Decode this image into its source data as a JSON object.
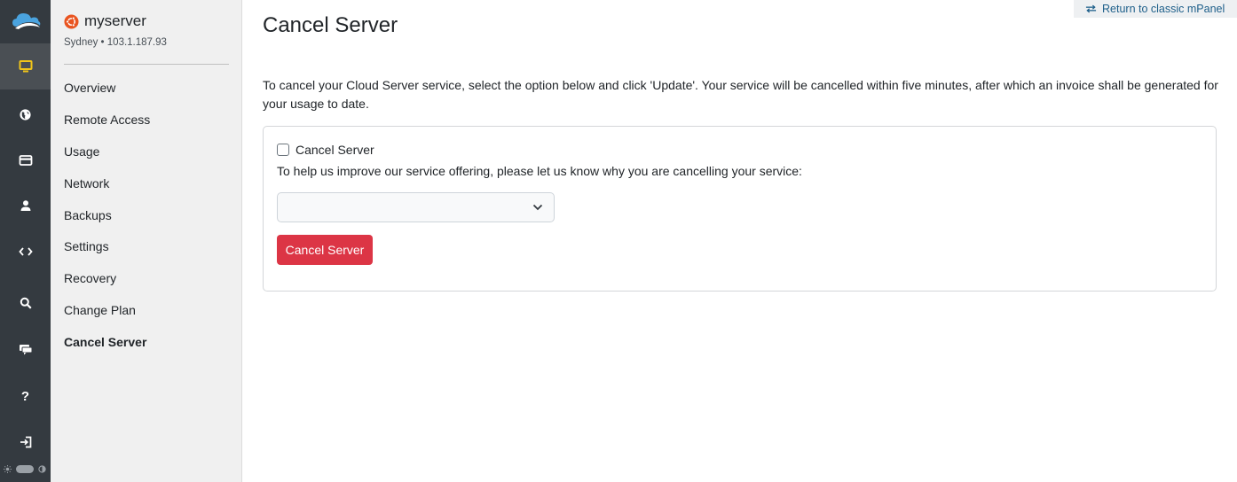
{
  "rail": {
    "items": [
      {
        "name": "servers-icon",
        "active": true
      },
      {
        "name": "globe-icon",
        "active": false
      },
      {
        "name": "billing-card-icon",
        "active": false
      },
      {
        "name": "account-user-icon",
        "active": false
      },
      {
        "name": "developer-code-icon",
        "active": false
      },
      {
        "name": "search-icon",
        "active": false
      },
      {
        "name": "support-chat-icon",
        "active": false
      },
      {
        "name": "help-question-icon",
        "active": false
      },
      {
        "name": "logout-icon",
        "active": false
      }
    ],
    "help_glyph": "?"
  },
  "server": {
    "name": "myserver",
    "meta": "Sydney • 103.1.187.93"
  },
  "subnav": {
    "items": [
      {
        "label": "Overview"
      },
      {
        "label": "Remote Access"
      },
      {
        "label": "Usage"
      },
      {
        "label": "Network"
      },
      {
        "label": "Backups"
      },
      {
        "label": "Settings"
      },
      {
        "label": "Recovery"
      },
      {
        "label": "Change Plan"
      },
      {
        "label": "Cancel Server"
      }
    ],
    "active_index": 8
  },
  "header": {
    "classic_link": "Return to classic mPanel"
  },
  "page": {
    "title": "Cancel Server",
    "intro": "To cancel your Cloud Server service, select the option below and click 'Update'. Your service will be cancelled within five minutes, after which an invoice shall be generated for your usage to date."
  },
  "form": {
    "checkbox_label": "Cancel Server",
    "checked": false,
    "reason_prompt": "To help us improve our service offering, please let us know why you are cancelling your service:",
    "reason_value": "",
    "submit_label": "Cancel Server"
  },
  "colors": {
    "accent_red": "#dc3545",
    "rail_bg": "#343a40",
    "active_icon": "#f0c419",
    "link_blue": "#1e5f8a",
    "ubuntu_orange": "#e95420"
  }
}
